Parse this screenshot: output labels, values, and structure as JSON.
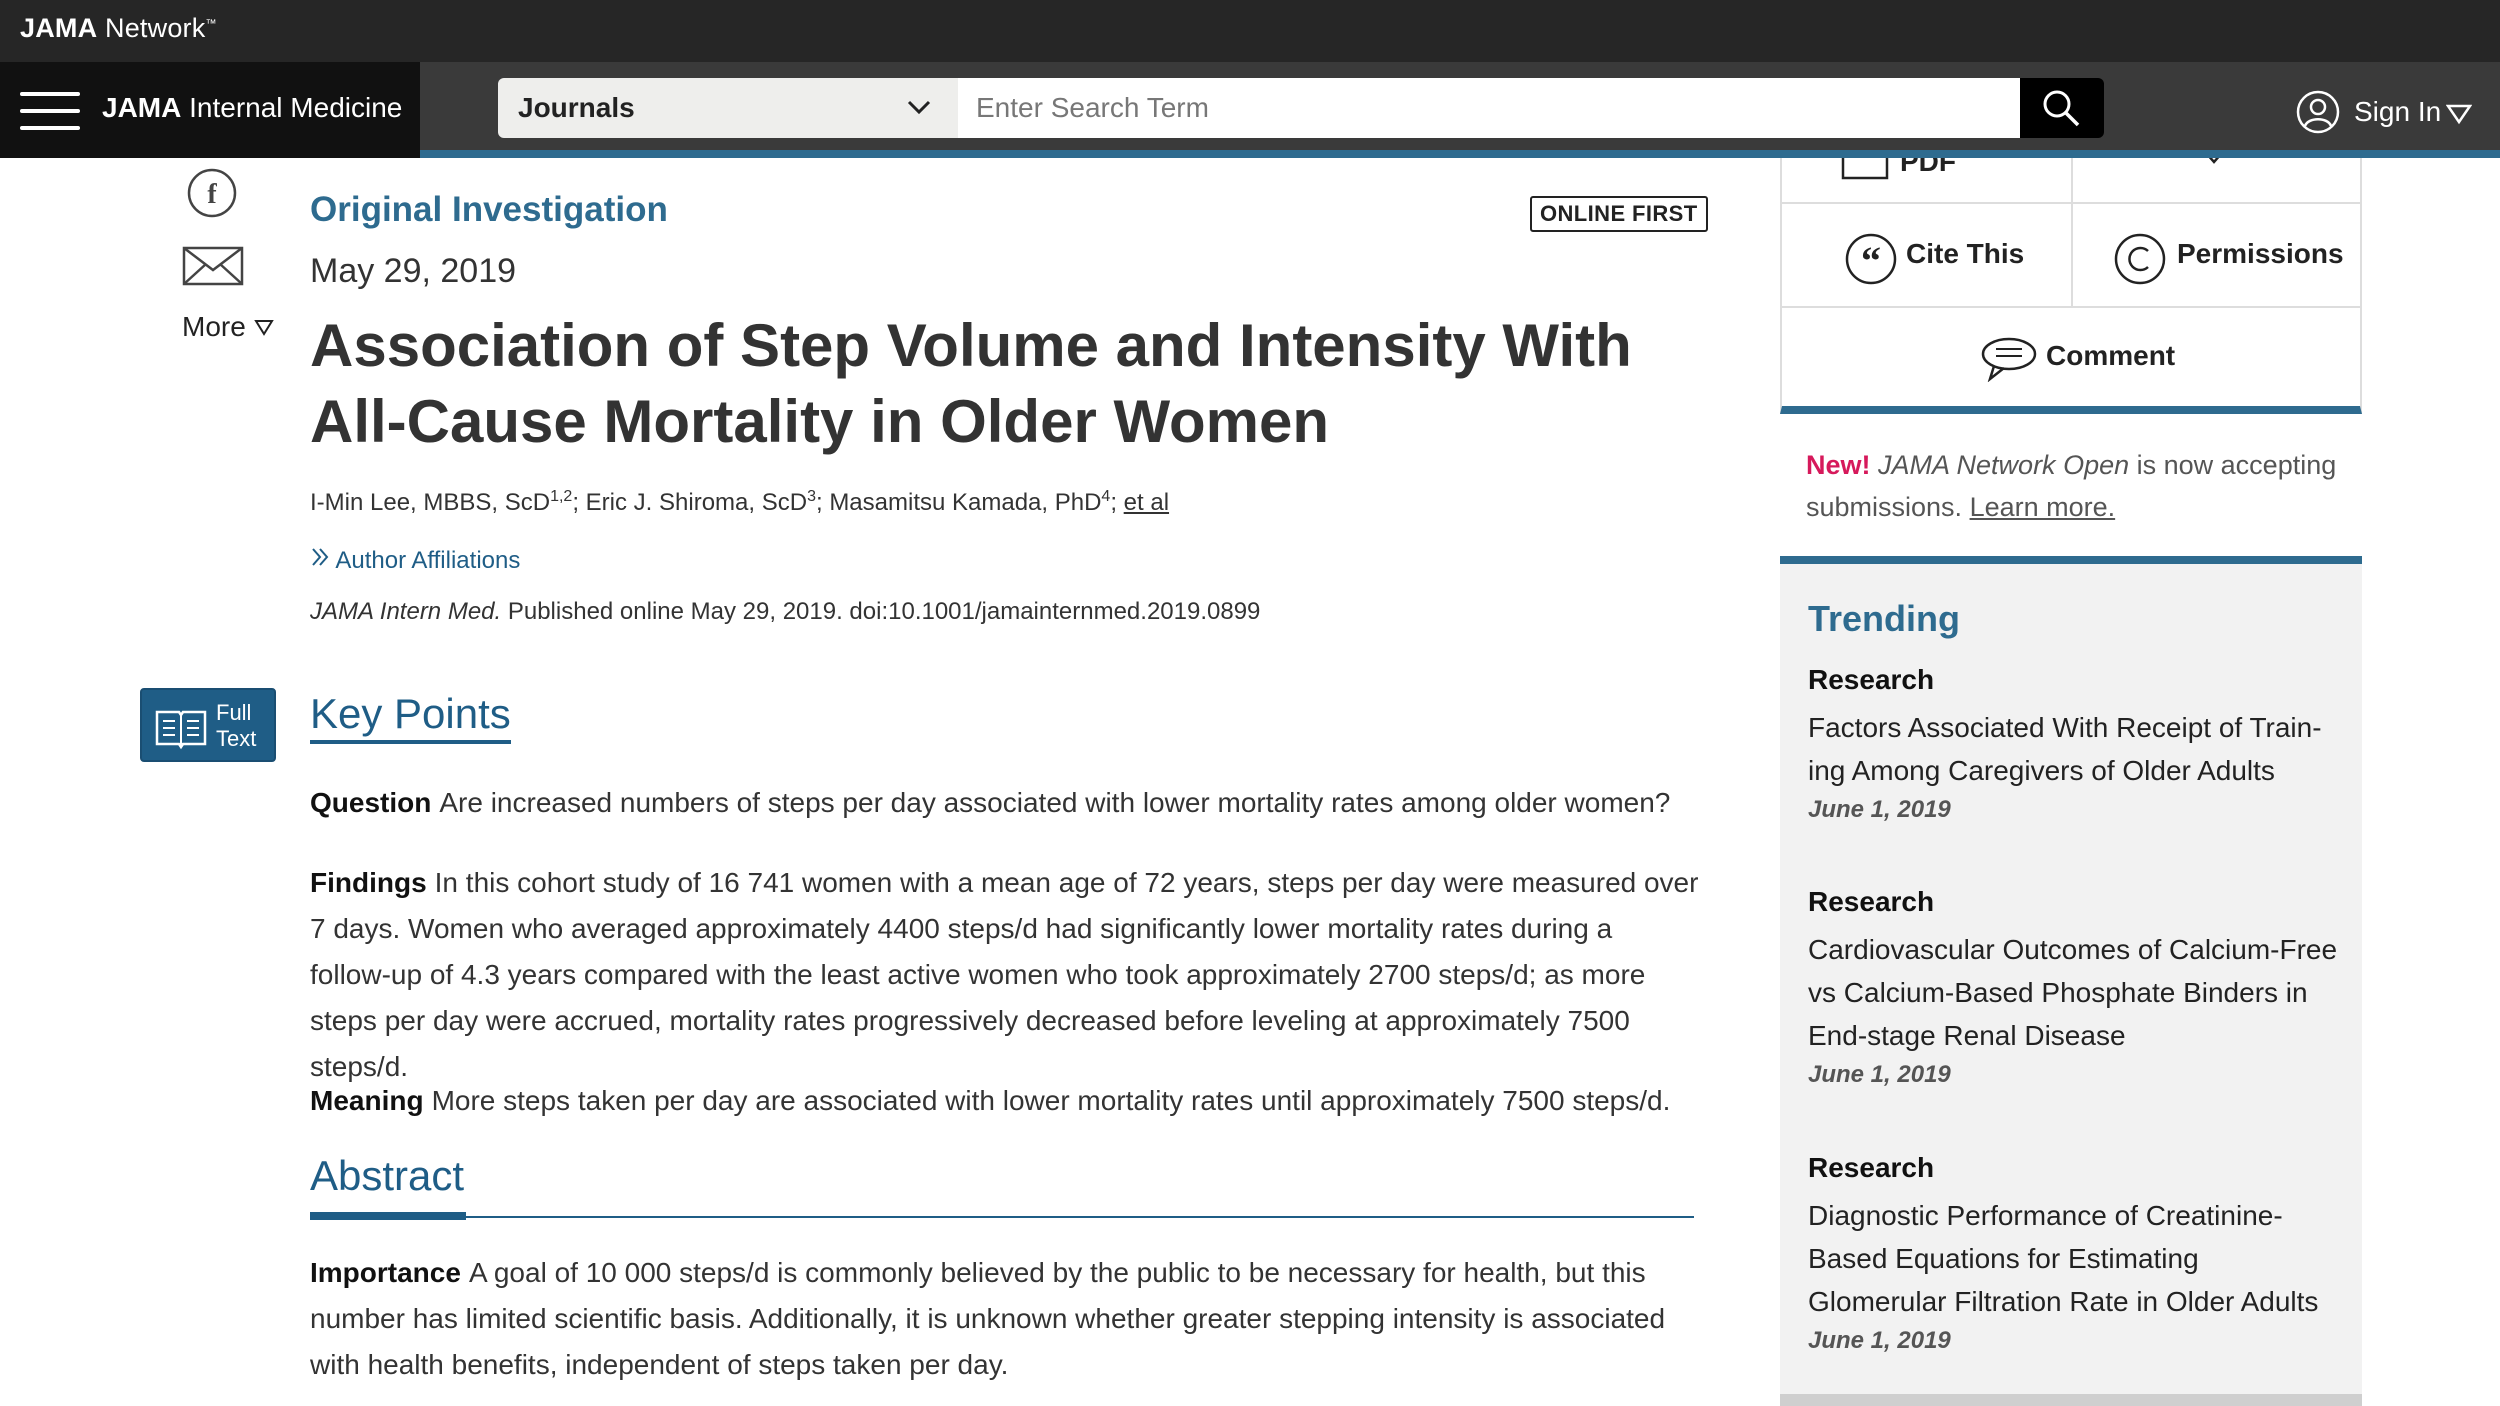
{
  "network": {
    "brand_bold": "JAMA",
    "brand_rest": " Network",
    "tm": "™"
  },
  "nav": {
    "journal_bold": "JAMA",
    "journal_rest": " Internal Medicine",
    "select_label": "Journals",
    "search_placeholder": "Enter Search Term",
    "sign_in": "Sign In"
  },
  "share": {
    "more_label": "More",
    "fulltext_line1": "Full",
    "fulltext_line2": "Text"
  },
  "article": {
    "type": "Original Investigation",
    "badge": "ONLINE FIRST",
    "date": "May 29, 2019",
    "title": "Association of Step Volume and Intensity With All-Cause Mortality in Older Women",
    "authors": [
      {
        "name": "I-Min Lee, MBBS, ScD",
        "sup": "1,2",
        "sep": "; "
      },
      {
        "name": "Eric J. Shiroma, ScD",
        "sup": "3",
        "sep": "; "
      },
      {
        "name": "Masamitsu Kamada, PhD",
        "sup": "4",
        "sep": "; "
      }
    ],
    "et_al": "et al",
    "affiliations_label": "Author Affiliations",
    "citation_journal": "JAMA Intern Med.",
    "citation_rest": " Published online May 29, 2019. doi:10.1001/jamainternmed.2019.0899"
  },
  "key_points": {
    "heading": "Key Points",
    "question_label": "Question",
    "question": "Are increased numbers of steps per day associated with lower mortality rates among older women?",
    "findings_label": "Findings",
    "findings": "In this cohort study of 16 741 women with a mean age of 72 years, steps per day were measured over 7 days. Women who averaged approximately 4400 steps/d had significantly lower mortality rates during a follow-up of 4.3 years compared with the least active women who took approximately 2700 steps/d; as more steps per day were accrued, mortality rates progressively decreased before leveling at approximately 7500 steps/d.",
    "meaning_label": "Meaning",
    "meaning": "More steps taken per day are associated with lower mortality rates until approximately 7500 steps/d."
  },
  "abstract": {
    "heading": "Abstract",
    "importance_label": "Importance",
    "importance": "A goal of 10 000 steps/d is commonly believed by the public to be necessary for health, but this number has limited scientific basis. Additionally, it is unknown whether greater stepping intensity is associated with health benefits, independent of steps taken per day."
  },
  "tools": {
    "pdf": "PDF",
    "cite": "Cite This",
    "permissions": "Permissions",
    "comment": "Comment"
  },
  "promo": {
    "new": "New!",
    "journal": "JAMA Network Open",
    "text": " is now accepting submissions. ",
    "link": "Learn more."
  },
  "trending": {
    "heading": "Trending",
    "items": [
      {
        "category": "Research",
        "title": "Factors Associated With Receipt of Train-ing Among Caregivers of Older Adults",
        "date": "June 1, 2019"
      },
      {
        "category": "Research",
        "title": "Cardiovascular Outcomes of Calcium-Free vs Calcium-Based Phosphate Binders in End-stage Renal Disease",
        "date": "June 1, 2019"
      },
      {
        "category": "Research",
        "title": "Diagnostic Performance of Creatinine-Based Equations for Estimating Glomerular Filtration Rate in Older Adults",
        "date": "June 1, 2019"
      }
    ]
  },
  "colors": {
    "accent": "#2e6b8f",
    "link": "#1f5d86",
    "new": "#d6195b"
  }
}
